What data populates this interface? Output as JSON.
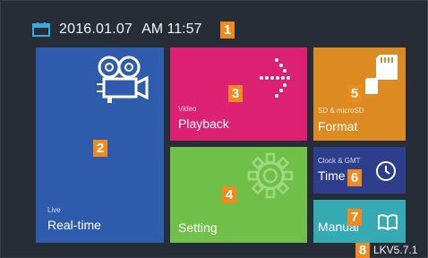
{
  "status": {
    "date": "2016.01.07",
    "time": "AM 11:57"
  },
  "markers": [
    "1",
    "2",
    "3",
    "4",
    "5",
    "6",
    "7",
    "8"
  ],
  "tiles": {
    "realtime": {
      "sub": "Live",
      "label": "Real-time",
      "color": "#2e5bab"
    },
    "playback": {
      "sub": "Video",
      "label": "Playback",
      "color": "#dc2173"
    },
    "format": {
      "sub": "SD & microSD",
      "label": "Format",
      "color": "#dc8a22"
    },
    "setting": {
      "label": "Setting",
      "color": "#6fbf48"
    },
    "time": {
      "sub": "Clock & GMT",
      "label": "Time",
      "color": "#2d3e8c"
    },
    "manual": {
      "label": "Manual",
      "color": "#36aab2"
    }
  },
  "icons": {
    "calendar": "calendar-icon",
    "camera": "video-camera-icon",
    "playback": "dotted-arrow-icon",
    "format": "sd-card-icon",
    "setting": "gear-icon",
    "time": "clock-icon",
    "manual": "book-icon"
  },
  "version": "LKV5.7.1",
  "colors": {
    "background": "#272d36",
    "marker": "#f08a1e"
  }
}
